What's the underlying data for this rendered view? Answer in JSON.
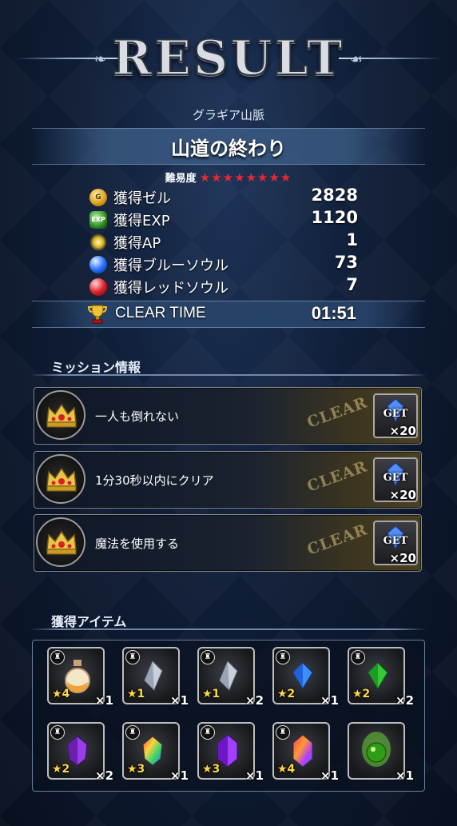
{
  "header": {
    "title": "RESULT"
  },
  "stage": {
    "area": "グラギア山脈",
    "name": "山道の終わり",
    "difficulty_label": "難易度",
    "difficulty_stars": "★★★★★★★★"
  },
  "rewards": [
    {
      "icon": "gil-coin-icon",
      "label": "獲得ゼル",
      "value": "2828"
    },
    {
      "icon": "exp-icon",
      "label": "獲得EXP",
      "value": "1120"
    },
    {
      "icon": "ap-sparkle-icon",
      "label": "獲得AP",
      "value": "1"
    },
    {
      "icon": "blue-soul-icon",
      "label": "獲得ブルーソウル",
      "value": "73"
    },
    {
      "icon": "red-soul-icon",
      "label": "獲得レッドソウル",
      "value": "7"
    }
  ],
  "clear_time": {
    "label": "CLEAR TIME",
    "value": "01:51"
  },
  "missions_section": {
    "title": "ミッション情報"
  },
  "missions": [
    {
      "label": "一人も倒れない",
      "stamp": "CLEAR",
      "get": "GET",
      "qty": "×20"
    },
    {
      "label": "1分30秒以内にクリア",
      "stamp": "CLEAR",
      "get": "GET",
      "qty": "×20"
    },
    {
      "label": "魔法を使用する",
      "stamp": "CLEAR",
      "get": "GET",
      "qty": "×20"
    }
  ],
  "items_section": {
    "title": "獲得アイテム"
  },
  "items": [
    {
      "icon": "potion-icon",
      "rarity": "★4",
      "count": "×1"
    },
    {
      "icon": "white-crystal-icon",
      "rarity": "★1",
      "count": "×1"
    },
    {
      "icon": "white-crystal-icon",
      "rarity": "★1",
      "count": "×2"
    },
    {
      "icon": "blue-crystal-icon",
      "rarity": "★2",
      "count": "×1"
    },
    {
      "icon": "green-crystal-icon",
      "rarity": "★2",
      "count": "×2"
    },
    {
      "icon": "purple-crystal-icon",
      "rarity": "★2",
      "count": "×2"
    },
    {
      "icon": "rainbow-crystal-icon",
      "rarity": "★3",
      "count": "×1"
    },
    {
      "icon": "purple-crystal-icon",
      "rarity": "★3",
      "count": "×1"
    },
    {
      "icon": "rainbow-crystal-icon",
      "rarity": "★4",
      "count": "×1"
    },
    {
      "icon": "green-orb-icon",
      "rarity": "",
      "count": "×1"
    }
  ],
  "colors": {
    "accent_red_star": "#e8282d",
    "rarity_gold": "#ffd84a",
    "band_blue": "#3a5a82"
  }
}
